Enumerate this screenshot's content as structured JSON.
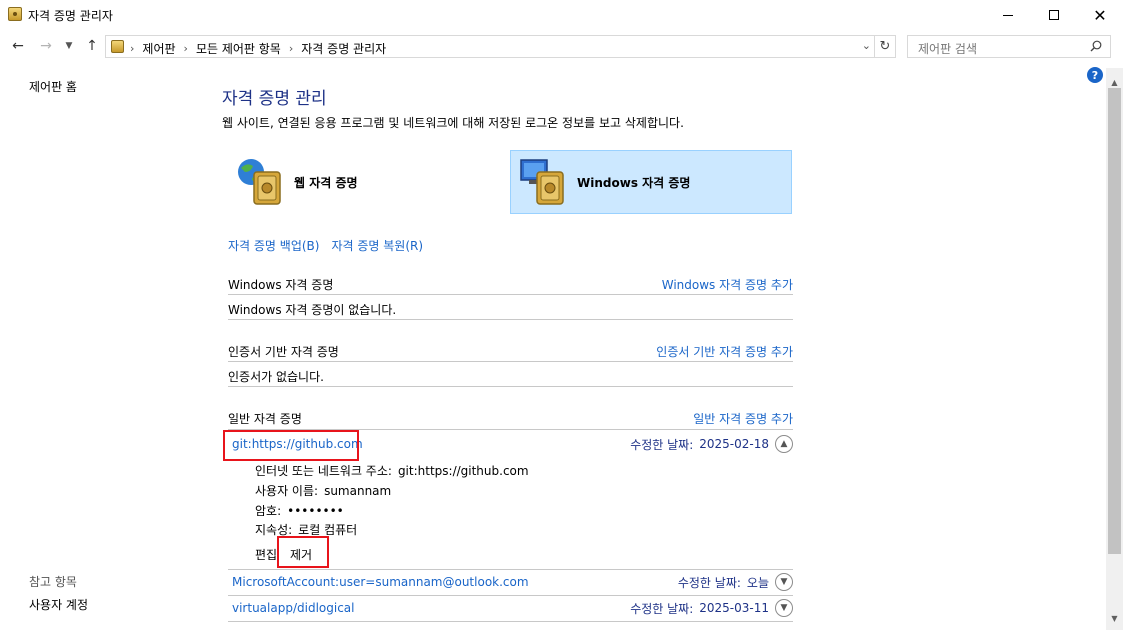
{
  "window": {
    "title": "자격 증명 관리자"
  },
  "nav": {
    "breadcrumbs": [
      "제어판",
      "모든 제어판 항목",
      "자격 증명 관리자"
    ],
    "search_placeholder": "제어판 검색"
  },
  "left": {
    "home": "제어판 홈",
    "see_also": "참고 항목",
    "user_accounts": "사용자 계정"
  },
  "main": {
    "title": "자격 증명 관리",
    "description": "웹 사이트, 연결된 응용 프로그램 및 네트워크에 대해 저장된 로그온 정보를 보고 삭제합니다.",
    "tiles": {
      "web": "웹 자격 증명",
      "windows": "Windows 자격 증명"
    },
    "backup": "자격 증명 백업(B)",
    "restore": "자격 증명 복원(R)",
    "windows_section": {
      "title": "Windows 자격 증명",
      "add": "Windows 자격 증명 추가",
      "empty": "Windows 자격 증명이 없습니다."
    },
    "cert_section": {
      "title": "인증서 기반 자격 증명",
      "add": "인증서 기반 자격 증명 추가",
      "empty": "인증서가 없습니다."
    },
    "generic_section": {
      "title": "일반 자격 증명",
      "add": "일반 자격 증명 추가"
    },
    "generic_items": [
      {
        "name": "git:https://github.com",
        "modified_label": "수정한 날짜:",
        "modified": "2025-02-18"
      },
      {
        "name": "MicrosoftAccount:user=sumannam@outlook.com",
        "modified_label": "수정한 날짜:",
        "modified": "오늘"
      },
      {
        "name": "virtualapp/didlogical",
        "modified_label": "수정한 날짜:",
        "modified": "2025-03-11"
      }
    ],
    "detail": {
      "address_label": "인터넷 또는 네트워크 주소:",
      "address": "git:https://github.com",
      "user_label": "사용자 이름:",
      "user": "sumannam",
      "password_label": "암호:",
      "password": "••••••••",
      "persistence_label": "지속성:",
      "persistence": "로컬 컴퓨터",
      "edit": "편집",
      "remove": "제거"
    }
  }
}
